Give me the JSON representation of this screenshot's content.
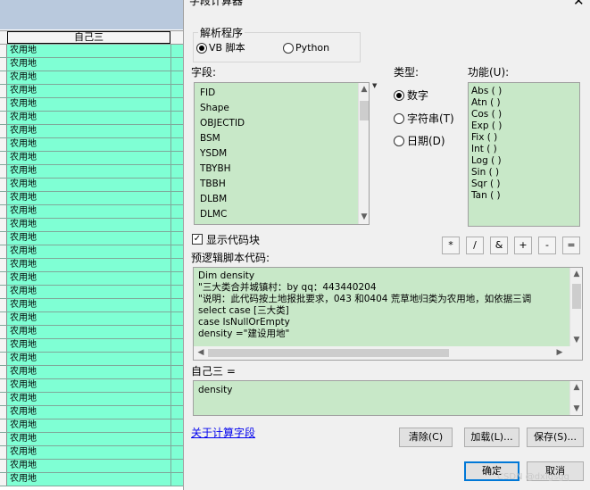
{
  "table": {
    "column_header": "自己三",
    "row_value": "农用地",
    "row_count": 33
  },
  "dialog": {
    "title": "字段计算器",
    "close_symbol": "✕",
    "parser": {
      "label": "解析程序",
      "options": [
        "VB 脚本",
        "Python"
      ],
      "selected": "VB 脚本"
    },
    "fields": {
      "label": "字段:",
      "items": [
        "FID",
        "Shape",
        "OBJECTID",
        "BSM",
        "YSDM",
        "TBYBH",
        "TBBH",
        "DLBM",
        "DLMC"
      ]
    },
    "types": {
      "label": "类型:",
      "options": [
        "数字",
        "字符串(T)",
        "日期(D)"
      ],
      "selected": "数字"
    },
    "functions": {
      "label": "功能(U):",
      "items": [
        "Abs ( )",
        "Atn ( )",
        "Cos ( )",
        "Exp ( )",
        "Fix ( )",
        "Int ( )",
        "Log ( )",
        "Sin ( )",
        "Sqr ( )",
        "Tan ( )"
      ]
    },
    "show_codeblock": {
      "label": "显示代码块",
      "checked": true
    },
    "operators": [
      "*",
      "/",
      "&",
      "+",
      "-",
      "="
    ],
    "prelogic": {
      "label": "预逻辑脚本代码:",
      "lines": [
        "Dim density",
        "\"三大类合并城镇村：by qq：443440204",
        "\"说明：此代码按土地报批要求，043 和0404 荒草地归类为农用地，如依据三调",
        "select case [三大类]",
        "case IsNullOrEmpty",
        "density =\"建设用地\""
      ]
    },
    "expression": {
      "label": "自己三 =",
      "value": "density"
    },
    "about_link": "关于计算字段",
    "buttons": {
      "clear": "清除(C)",
      "load": "加载(L)...",
      "save": "保存(S)...",
      "ok": "确定",
      "cancel": "取消"
    },
    "watermark": "CSDN @dxlgsgq"
  }
}
